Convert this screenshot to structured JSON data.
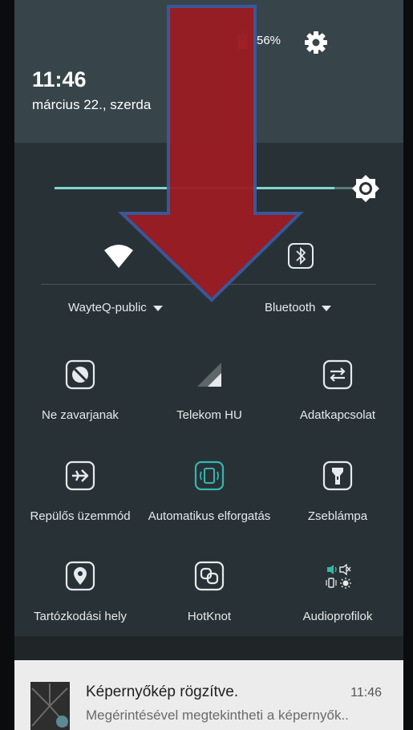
{
  "status": {
    "battery_percent": "56%",
    "battery_level": 0.56
  },
  "header": {
    "time": "11:46",
    "date": "március 22., szerda"
  },
  "brightness": {
    "level": 0.93
  },
  "connections": [
    {
      "label": "WayteQ-public",
      "icon": "wifi-icon"
    },
    {
      "label": "Bluetooth",
      "icon": "bluetooth-icon"
    }
  ],
  "tiles": [
    {
      "label": "Ne zavarjanak",
      "icon": "do-not-disturb-icon"
    },
    {
      "label": "Telekom HU",
      "icon": "signal-icon"
    },
    {
      "label": "Adatkapcsolat",
      "icon": "data-connection-icon"
    },
    {
      "label": "Repülős üzemmód",
      "icon": "airplane-icon"
    },
    {
      "label": "Automatikus elforgatás",
      "icon": "auto-rotate-icon",
      "active": true
    },
    {
      "label": "Zseblámpa",
      "icon": "flashlight-icon"
    },
    {
      "label": "Tartózkodási hely",
      "icon": "location-icon"
    },
    {
      "label": "HotKnot",
      "icon": "hotknot-icon"
    },
    {
      "label": "Audioprofilok",
      "icon": "audio-profile-icon"
    }
  ],
  "notification": {
    "title": "Képernyőkép rögzítve.",
    "time": "11:46",
    "text": "Megérintésével megtekintheti a képernyők.."
  },
  "overlay": {
    "arrow_color": "#9b1c22",
    "arrow_outline": "#3b5a9e"
  },
  "colors": {
    "accent": "#39b4ad",
    "header_bg": "#37444a",
    "panel_bg": "#283236"
  }
}
